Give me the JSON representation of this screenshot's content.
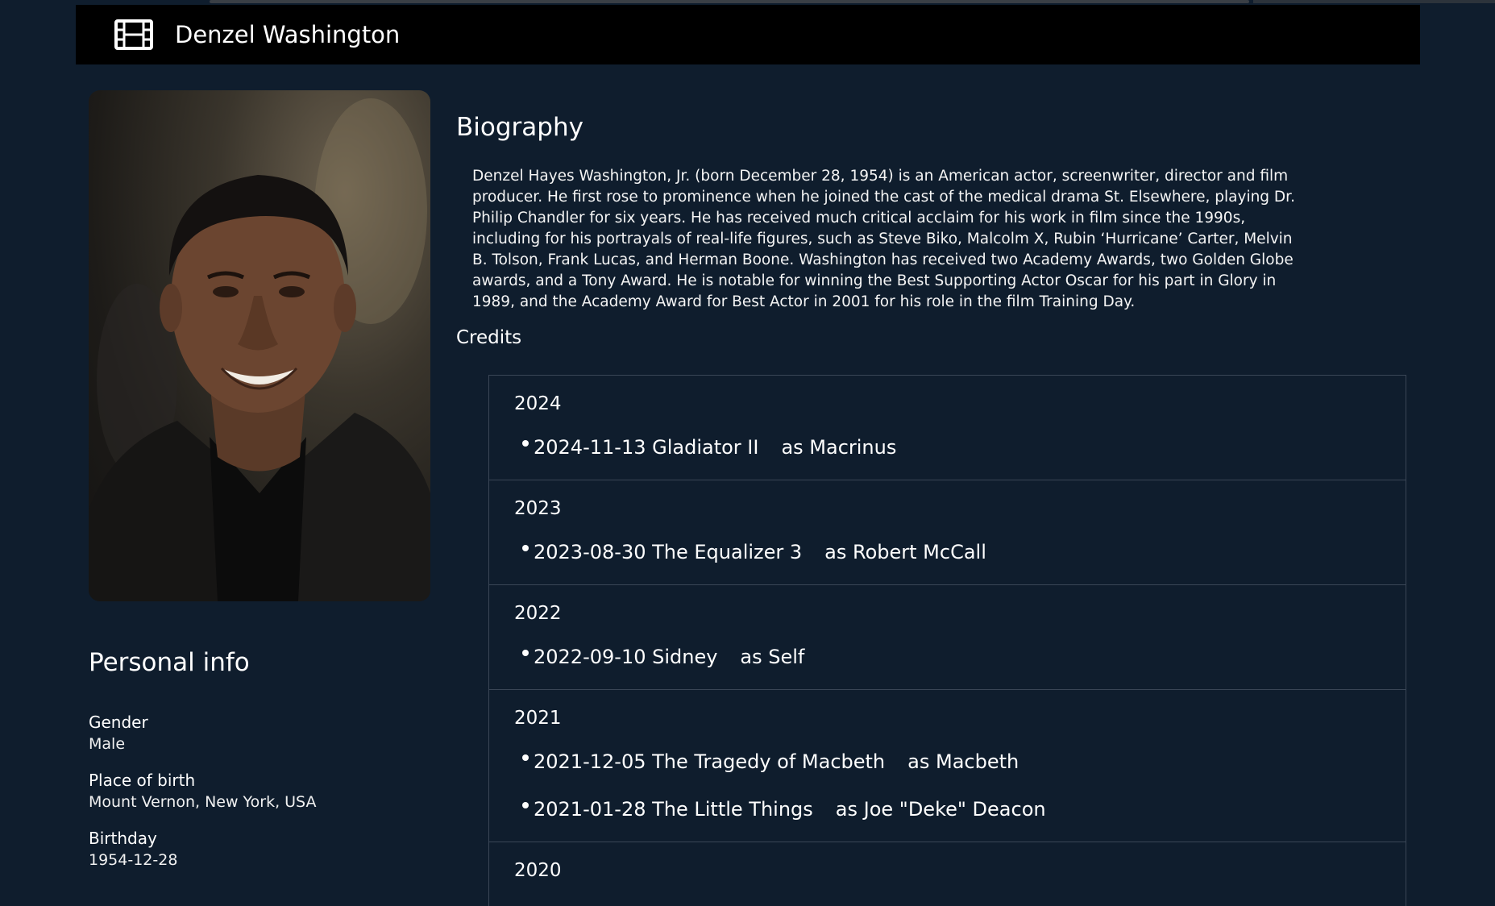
{
  "header": {
    "icon": "film-icon",
    "title": "Denzel Washington"
  },
  "sidebar": {
    "photo_alt": "Denzel Washington",
    "personal_info_title": "Personal info",
    "info": [
      {
        "label": "Gender",
        "value": "Male"
      },
      {
        "label": "Place of birth",
        "value": "Mount Vernon, New York, USA"
      },
      {
        "label": "Birthday",
        "value": "1954-12-28"
      }
    ]
  },
  "biography": {
    "title": "Biography",
    "text": "Denzel Hayes Washington, Jr. (born December 28, 1954) is an American actor, screenwriter, director and film producer. He first rose to prominence when he joined the cast of the medical drama St. Elsewhere, playing Dr. Philip Chandler for six years. He has received much critical acclaim for his work in film since the 1990s, including for his portrayals of real-life figures, such as Steve Biko, Malcolm X, Rubin ‘Hurricane’ Carter, Melvin B. Tolson, Frank Lucas, and Herman Boone. Washington has received two Academy Awards, two Golden Globe awards, and a Tony Award. He is notable for winning the Best Supporting Actor Oscar for his part in Glory in 1989, and the Academy Award for Best Actor in 2001 for his role in the film Training Day."
  },
  "credits": {
    "title": "Credits",
    "years": [
      {
        "year": "2024",
        "items": [
          {
            "date_title": "2024-11-13 Gladiator II",
            "role": "as Macrinus"
          }
        ]
      },
      {
        "year": "2023",
        "items": [
          {
            "date_title": "2023-08-30 The Equalizer 3",
            "role": "as Robert McCall"
          }
        ]
      },
      {
        "year": "2022",
        "items": [
          {
            "date_title": "2022-09-10 Sidney",
            "role": "as Self"
          }
        ]
      },
      {
        "year": "2021",
        "items": [
          {
            "date_title": "2021-12-05 The Tragedy of Macbeth",
            "role": "as Macbeth"
          },
          {
            "date_title": "2021-01-28 The Little Things",
            "role": "as Joe \"Deke\" Deacon"
          }
        ]
      },
      {
        "year": "2020",
        "items": []
      }
    ]
  }
}
